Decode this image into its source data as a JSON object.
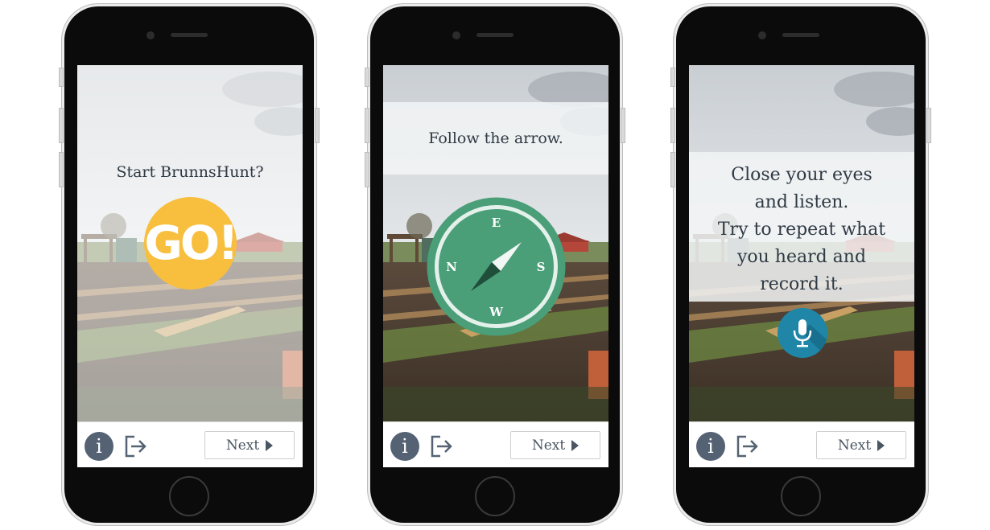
{
  "screens": [
    {
      "prompt": "Start BrunnsHunt?",
      "action_label": "GO!"
    },
    {
      "prompt": "Follow the arrow.",
      "compass": {
        "north": "E",
        "west": "N",
        "east": "S",
        "south": "W"
      }
    },
    {
      "prompt_lines": [
        "Close your eyes",
        "and listen.",
        "Try to repeat what",
        "you heard and",
        "record it."
      ],
      "action_icon": "microphone-icon"
    }
  ],
  "bottom_bar": {
    "info_label": "i",
    "next_label": "Next"
  },
  "colors": {
    "go_yellow": "#f8be3e",
    "compass_green": "#4a9e78",
    "mic_blue": "#1f86a8",
    "info_gray": "#546273"
  }
}
